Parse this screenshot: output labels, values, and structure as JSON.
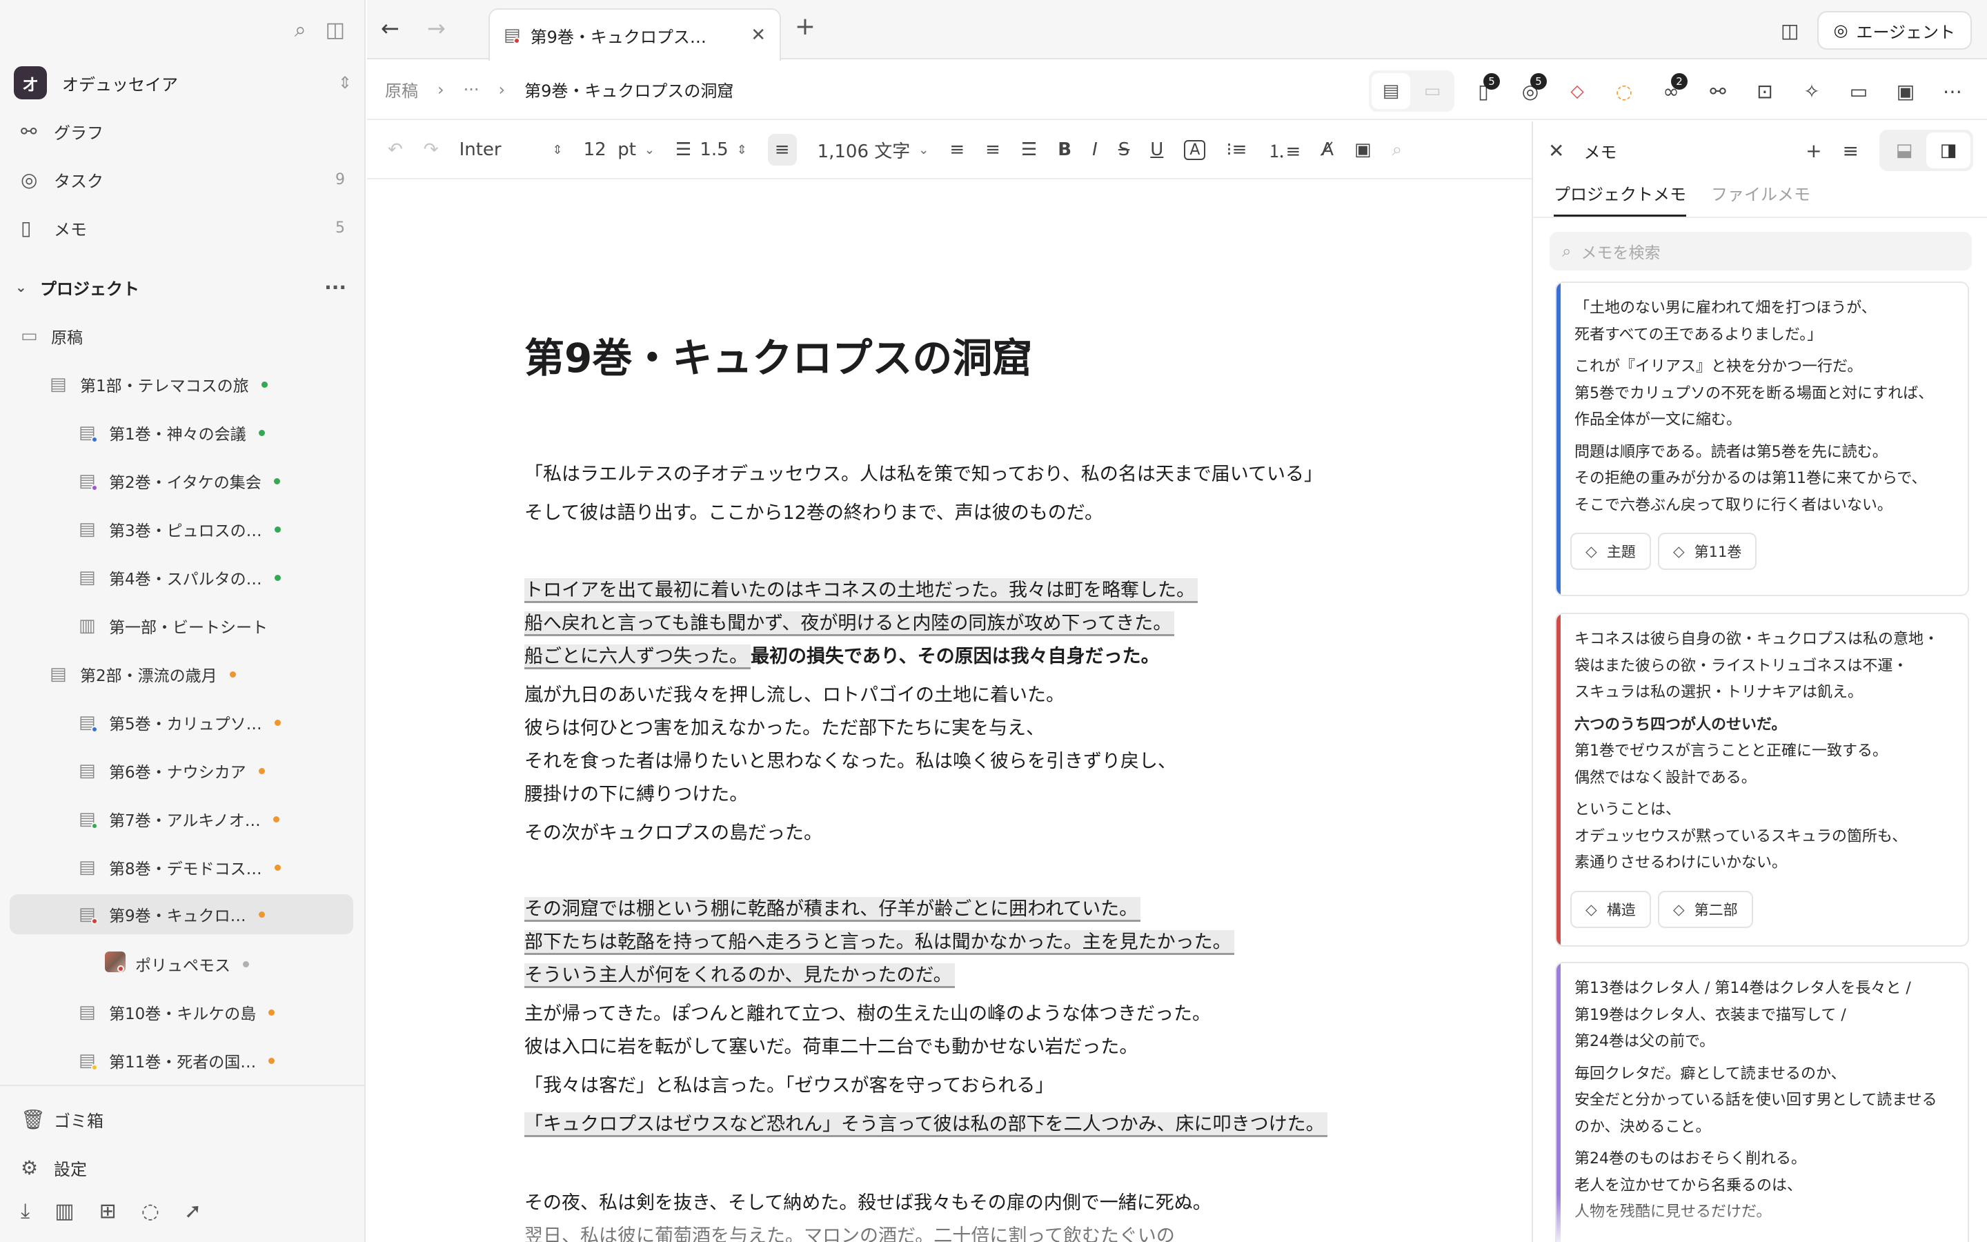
{
  "workspace": {
    "avatar_letter": "オ",
    "name": "オデュッセイア"
  },
  "nav": [
    {
      "label": "グラフ",
      "icon": "graph-icon",
      "count": ""
    },
    {
      "label": "タスク",
      "icon": "task-check-icon",
      "count": "9"
    },
    {
      "label": "メモ",
      "icon": "memo-icon",
      "count": "5"
    }
  ],
  "project": {
    "header": "プロジェクト"
  },
  "tree": [
    {
      "label": "原稿",
      "type": "folder",
      "dot": ""
    },
    {
      "label": "第1部・テレマコスの旅",
      "type": "doc",
      "dot": "#34a853"
    },
    {
      "label": "第1巻・神々の会議",
      "type": "doc",
      "dot": "#34a853",
      "badge": "#3b6fd8"
    },
    {
      "label": "第2巻・イタケの集会",
      "type": "doc",
      "dot": "#34a853",
      "badge": "#9b59d0"
    },
    {
      "label": "第3巻・ピュロスの…",
      "type": "doc",
      "dot": "#34a853"
    },
    {
      "label": "第4巻・スパルタの…",
      "type": "doc",
      "dot": "#34a853"
    },
    {
      "label": "第一部・ビートシート",
      "type": "sheet",
      "dot": ""
    },
    {
      "label": "第2部・漂流の歳月",
      "type": "doc",
      "dot": "#f0962e"
    },
    {
      "label": "第5巻・カリュプソ…",
      "type": "doc",
      "dot": "#f0962e",
      "badge": "#3b6fd8"
    },
    {
      "label": "第6巻・ナウシカア",
      "type": "doc",
      "dot": "#f0962e"
    },
    {
      "label": "第7巻・アルキノオ…",
      "type": "doc",
      "dot": "#f0962e",
      "badge": "#34a853"
    },
    {
      "label": "第8巻・デモドコス…",
      "type": "doc",
      "dot": "#f0962e"
    },
    {
      "label": "第9巻・キュクロ…",
      "type": "doc",
      "dot": "#f0962e",
      "badge": "#d93a3a"
    },
    {
      "label": "ポリュペモス",
      "type": "image",
      "dot": "#b0b0b0",
      "badge": "#d93a3a"
    },
    {
      "label": "第10巻・キルケの島",
      "type": "doc",
      "dot": "#f0962e"
    },
    {
      "label": "第11巻・死者の国…",
      "type": "doc",
      "dot": "#f0962e",
      "badge": "#f0c22e"
    }
  ],
  "sidebar_bottom": {
    "trash": "ゴミ箱",
    "settings": "設定"
  },
  "tab": {
    "title": "第9巻・キュクロプス…"
  },
  "agent_label": "エージェント",
  "breadcrumb": {
    "root": "原稿",
    "ellipsis": "···",
    "current": "第9巻・キュクロプスの洞窟"
  },
  "toolbar_counts": {
    "pages": "5",
    "tasks": "5",
    "links": "2"
  },
  "format": {
    "font": "Inter",
    "size": "12",
    "unit": "pt",
    "line_height": "1.5",
    "word_count": "1,106 文字"
  },
  "document": {
    "title": "第9巻・キュクロプスの洞窟",
    "lines": [
      "「私はラエルテスの子オデュッセウス。人は私を策で知っており、私の名は天まで届いている」",
      "そして彼は語り出す。ここから12巻の終わりまで、声は彼のものだ。",
      "トロイアを出て最初に着いたのはキコネスの土地だった。我々は町を略奪した。",
      "船へ戻れと言っても誰も聞かず、夜が明けると内陸の同族が攻め下ってきた。",
      "船ごとに六人ずつ失った。",
      "最初の損失であり、その原因は我々自身だった。",
      "嵐が九日のあいだ我々を押し流し、ロトパゴイの土地に着いた。",
      "彼らは何ひとつ害を加えなかった。ただ部下たちに実を与え、",
      "それを食った者は帰りたいと思わなくなった。私は喚く彼らを引きずり戻し、",
      "腰掛けの下に縛りつけた。",
      "その次がキュクロプスの島だった。",
      "その洞窟では棚という棚に乾酪が積まれ、仔羊が齢ごとに囲われていた。",
      "部下たちは乾酪を持って船へ走ろうと言った。私は聞かなかった。主を見たかった。",
      "そういう主人が何をくれるのか、見たかったのだ。",
      "主が帰ってきた。ぽつんと離れて立つ、樹の生えた山の峰のような体つきだった。",
      "彼は入口に岩を転がして塞いだ。荷車二十二台でも動かせない岩だった。",
      "「我々は客だ」と私は言った。「ゼウスが客を守っておられる」",
      "「キュクロプスはゼウスなど恐れん」そう言って彼は私の部下を二人つかみ、床に叩きつけた。",
      "その夜、私は剣を抜き、そして納めた。殺せば我々もその扉の内側で一緒に死ぬ。",
      "翌日、私は彼に葡萄酒を与えた。マロンの酒だ。二十倍に割って飲むたぐいの"
    ]
  },
  "memo_panel": {
    "title": "メモ",
    "tab_project": "プロジェクトメモ",
    "tab_file": "ファイルメモ",
    "search_placeholder": "メモを検索",
    "cards": [
      {
        "color": "#3b6fd8",
        "paragraphs": [
          [
            "「土地のない男に雇われて畑を打つほうが、",
            "死者すべての王であるよりましだ。」"
          ],
          [
            "これが『イリアス』と袂を分かつ一行だ。",
            "第5巻でカリュプソの不死を断る場面と対にすれば、",
            "作品全体が一文に縮む。"
          ],
          [
            "問題は順序である。読者は第5巻を先に読む。",
            "その拒絶の重みが分かるのは第11巻に来てからで、",
            "そこで六巻ぶん戻って取りに行く者はいない。"
          ]
        ],
        "tags": [
          "主題",
          "第11巻"
        ]
      },
      {
        "color": "#d24b4b",
        "paragraphs": [
          [
            "キコネスは彼ら自身の欲・キュクロプスは私の意地・",
            "袋はまた彼らの欲・ライストリュゴネスは不運・",
            "スキュラは私の選択・トリナキアは飢え。"
          ],
          [
            "六つのうち四つが人のせいだ。",
            "第1巻でゼウスが言うことと正確に一致する。",
            "偶然ではなく設計である。"
          ],
          [
            "ということは、",
            "オデュッセウスが黙っているスキュラの箇所も、",
            "素通りさせるわけにいかない。"
          ]
        ],
        "tags": [
          "構造",
          "第二部"
        ]
      },
      {
        "color": "#9b7fd6",
        "paragraphs": [
          [
            "第13巻はクレタ人 / 第14巻はクレタ人を長々と /",
            "第19巻はクレタ人、衣装まで描写して /",
            "第24巻は父の前で。"
          ],
          [
            "毎回クレタだ。癖として読ませるのか、",
            "安全だと分かっている話を使い回す男として読ませる",
            "のか、決めること。"
          ],
          [
            "第24巻のものはおそらく削れる。",
            "老人を泣かせてから名乗るのは、",
            "人物を残酷に見せるだけだ。"
          ]
        ],
        "tags": []
      }
    ]
  }
}
